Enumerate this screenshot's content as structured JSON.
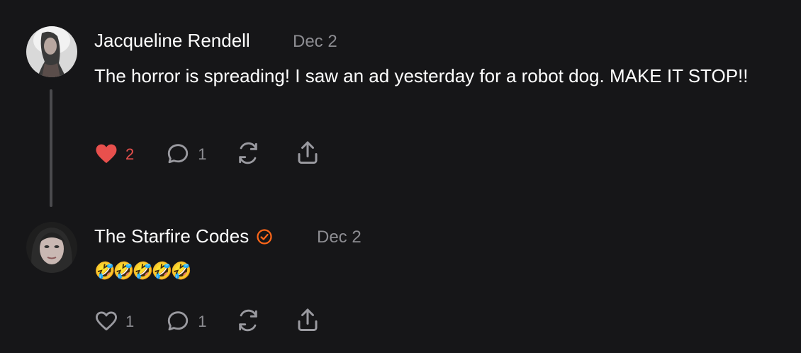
{
  "comments": [
    {
      "author": "Jacqueline Rendell",
      "date": "Dec 2",
      "text": "The horror is spreading! I saw an ad yesterday for a robot dog. MAKE IT STOP!!",
      "verified": false,
      "liked": true,
      "like_count": "2",
      "reply_count": "1"
    },
    {
      "author": "The Starfire Codes",
      "date": "Dec 2",
      "text": "🤣🤣🤣🤣🤣",
      "verified": true,
      "liked": false,
      "like_count": "1",
      "reply_count": "1"
    }
  ],
  "colors": {
    "background": "#161618",
    "like_active": "#e8504d",
    "verified_badge": "#ff6719",
    "muted_text": "#8d8d92",
    "thread_line": "#4a4a4d"
  },
  "icons": {
    "like": "heart-icon",
    "reply": "comment-bubble-icon",
    "restack": "restack-icon",
    "share": "share-icon",
    "verified": "verified-check-icon"
  }
}
